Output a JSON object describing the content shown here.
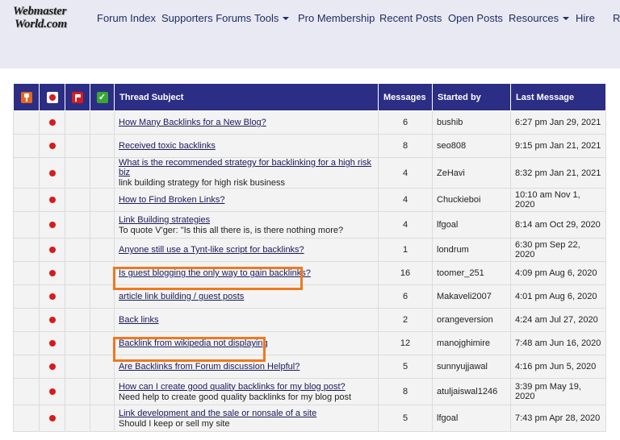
{
  "logo": {
    "line1": "Webmaster",
    "line2": "World.com"
  },
  "nav": [
    {
      "label": "Forum Index",
      "dropdown": false
    },
    {
      "label": "Supporters Forums",
      "dropdown": false
    },
    {
      "label": "Tools",
      "dropdown": true
    },
    {
      "label": "Pro Membership",
      "dropdown": false
    },
    {
      "label": "Recent Posts",
      "dropdown": false
    },
    {
      "label": "Open Posts",
      "dropdown": false
    },
    {
      "label": "Resources",
      "dropdown": true
    },
    {
      "label": "Hire",
      "dropdown": false
    },
    {
      "label": "Reg",
      "dropdown": false
    }
  ],
  "table": {
    "headers": {
      "pin_icon": "pin-icon",
      "status_icon": "status-dot-icon",
      "flag_icon": "flag-icon",
      "check_icon": "check-icon",
      "subject": "Thread Subject",
      "messages": "Messages",
      "started_by": "Started by",
      "last_message": "Last Message"
    },
    "accent_colors": {
      "header_bg": "#2b2e84",
      "highlight": "#f0781e",
      "dot": "#d81b1b"
    },
    "rows": [
      {
        "title": "How Many Backlinks for a New Blog?",
        "subtitle": "",
        "messages": "6",
        "started_by": "bushib",
        "last_message": "6:27 pm Jan 29, 2021"
      },
      {
        "title": "Received toxic backlinks",
        "subtitle": "",
        "messages": "8",
        "started_by": "seo808",
        "last_message": "9:15 pm Jan 21, 2021"
      },
      {
        "title": "What is the recommended strategy for backlinking for a high risk biz",
        "subtitle": "link building strategy for high risk business",
        "messages": "4",
        "started_by": "ZeHavi",
        "last_message": "8:32 pm Jan 21, 2021"
      },
      {
        "title": "How to Find Broken Links?",
        "subtitle": "",
        "messages": "4",
        "started_by": "Chuckieboi",
        "last_message": "10:10 am Nov 1, 2020"
      },
      {
        "title": "Link Building strategies",
        "subtitle": "To quote V'ger: \"Is this all there is, is there nothing more?",
        "messages": "4",
        "started_by": "lfgoal",
        "last_message": "8:14 am Oct 29, 2020"
      },
      {
        "title": "Anyone still use a Tynt-like script for backlinks?",
        "subtitle": "",
        "messages": "1",
        "started_by": "londrum",
        "last_message": "6:30 pm Sep 22, 2020"
      },
      {
        "title": "Is guest blogging the only way to gain backlinks?",
        "subtitle": "",
        "messages": "16",
        "started_by": "toomer_251",
        "last_message": "4:09 pm Aug 6, 2020"
      },
      {
        "title": "article link building / guest posts",
        "subtitle": "",
        "messages": "6",
        "started_by": "Makaveli2007",
        "last_message": "4:01 pm Aug 6, 2020"
      },
      {
        "title": "Back links",
        "subtitle": "",
        "messages": "2",
        "started_by": "orangeversion",
        "last_message": "4:24 am Jul 27, 2020"
      },
      {
        "title": "Backlink from wikipedia not displaying",
        "subtitle": "",
        "messages": "12",
        "started_by": "manojghimire",
        "last_message": "7:48 am Jun 16, 2020"
      },
      {
        "title": "Are Backlinks from Forum discussion Helpful?",
        "subtitle": "",
        "messages": "5",
        "started_by": "sunnyujjawal",
        "last_message": "4:16 pm Jun 5, 2020"
      },
      {
        "title": "How can I create good quality backlinks for my blog post?",
        "subtitle": "Need help to create good quality backlinks for my blog post",
        "messages": "8",
        "started_by": "atuljaiswal1246",
        "last_message": "3:39 pm May 19, 2020"
      },
      {
        "title": "Link development and the sale or nonsale of a site",
        "subtitle": "Should I keep or sell my site",
        "messages": "5",
        "started_by": "lfgoal",
        "last_message": "7:43 pm Apr 28, 2020"
      }
    ]
  }
}
